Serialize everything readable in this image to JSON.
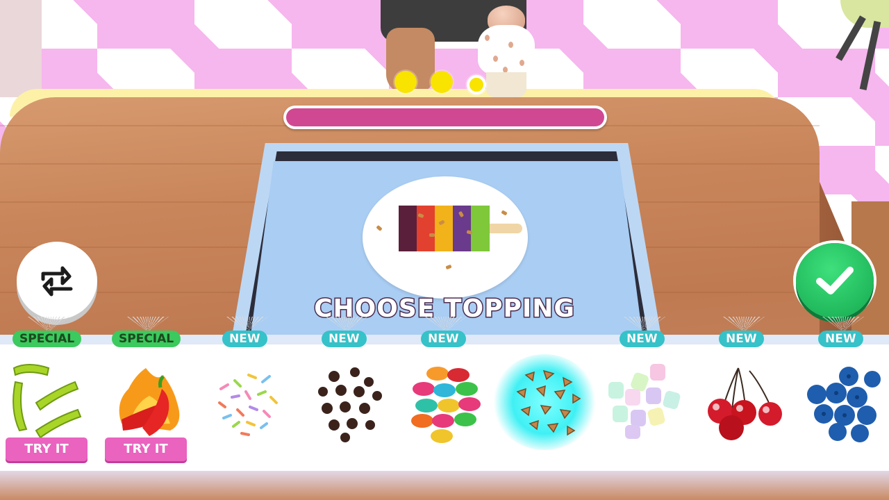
{
  "game": {
    "progress_dots": [
      {
        "filled": true
      },
      {
        "filled": true
      },
      {
        "filled": false
      }
    ],
    "progress_fraction": 1.0,
    "prompt_label": "CHOOSE TOPPING"
  },
  "buttons": {
    "swap_icon": "swap-arrows-icon",
    "confirm_icon": "checkmark-icon"
  },
  "toppings": [
    {
      "name": "Worms",
      "badge": "SPECIAL",
      "badge_type": "special",
      "action": "TRY IT",
      "icon": "gummy-worms-icon",
      "selected": false
    },
    {
      "name": "Chili Peppers",
      "badge": "SPECIAL",
      "badge_type": "special",
      "action": "TRY IT",
      "icon": "chili-peppers-icon",
      "selected": false
    },
    {
      "name": "Sprinkles",
      "badge": "NEW",
      "badge_type": "new",
      "icon": "sprinkles-icon",
      "selected": false
    },
    {
      "name": "Chocolate Chips",
      "badge": "NEW",
      "badge_type": "new",
      "icon": "chocolate-chips-icon",
      "selected": false
    },
    {
      "name": "Candy Buttons",
      "badge": "NEW",
      "badge_type": "new",
      "icon": "candy-buttons-icon",
      "selected": false
    },
    {
      "name": "Chopped Nuts",
      "badge": "",
      "badge_type": "none",
      "icon": "chopped-nuts-icon",
      "selected": true
    },
    {
      "name": "Marshmallows",
      "badge": "NEW",
      "badge_type": "new",
      "icon": "marshmallows-icon",
      "selected": false
    },
    {
      "name": "Cherries",
      "badge": "NEW",
      "badge_type": "new",
      "icon": "cherries-icon",
      "selected": false
    },
    {
      "name": "Blueberries",
      "badge": "NEW",
      "badge_type": "new",
      "icon": "blueberries-icon",
      "selected": false
    }
  ],
  "colors": {
    "progress_fill": "#d14892",
    "special_badge": "#3cc95e",
    "new_badge": "#35c2c9",
    "try_button": "#e963bf",
    "confirm_button": "#1fc35f"
  }
}
